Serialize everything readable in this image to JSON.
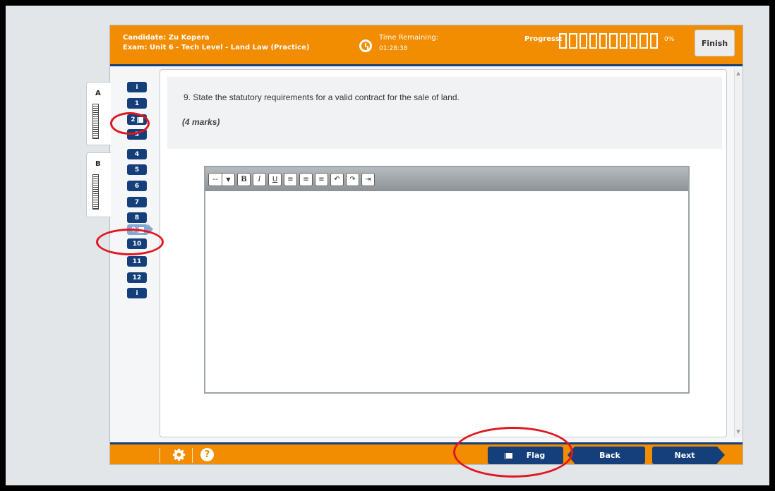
{
  "header": {
    "candidate": "Candidate: Zu Kopera",
    "exam": "Exam: Unit 6 - Tech Level - Land Law (Practice)",
    "time_label": "Time Remaining:",
    "time_value": "01:28:38",
    "progress_label": "Progress:",
    "progress_value": "0%",
    "progress_fraction": 0,
    "finish_label": "Finish"
  },
  "sections": [
    {
      "letter": "A"
    },
    {
      "letter": "B"
    }
  ],
  "nav": {
    "info_label": "i",
    "items": [
      {
        "label": "1",
        "flagged": false
      },
      {
        "label": "2",
        "flagged": true
      },
      {
        "label": "3",
        "flagged": false
      },
      {
        "label": "4",
        "flagged": false
      },
      {
        "label": "5",
        "flagged": false
      },
      {
        "label": "6",
        "flagged": false
      },
      {
        "label": "7",
        "flagged": false
      },
      {
        "label": "8",
        "flagged": false
      },
      {
        "label": "9",
        "flagged": true,
        "current": true
      },
      {
        "label": "10",
        "flagged": false
      },
      {
        "label": "11",
        "flagged": false
      },
      {
        "label": "12",
        "flagged": false
      }
    ]
  },
  "question": {
    "text": "9.  State the statutory requirements for a valid contract for the sale of land.",
    "marks": "(4 marks)"
  },
  "editor": {
    "font_select": "--",
    "dropdown_glyph": "▼",
    "bold": "B",
    "italic": "I",
    "underline": "U",
    "align_left": "≡",
    "align_center": "≡",
    "align_right": "≡",
    "undo": "↶",
    "redo": "↷",
    "indent": "⇥"
  },
  "footer": {
    "help_glyph": "?",
    "flag_label": "Flag",
    "back_label": "Back",
    "next_label": "Next"
  },
  "colors": {
    "accent": "#f28c00",
    "navy": "#153f7a",
    "annotation": "#e0171f"
  }
}
